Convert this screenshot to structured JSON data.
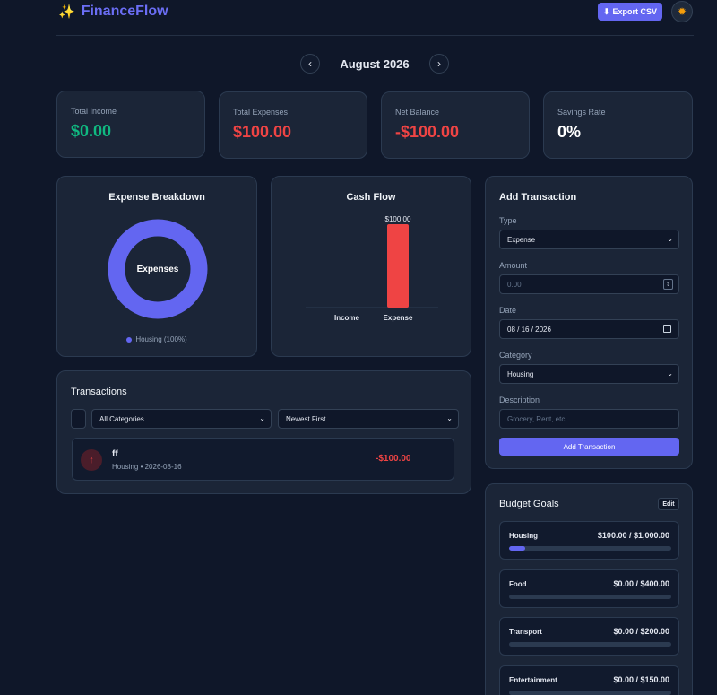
{
  "header": {
    "brand": "FinanceFlow",
    "brand_icon": "sparkles-icon",
    "export_label": "Export CSV",
    "theme_icon": "sun-icon"
  },
  "month_nav": {
    "label": "August 2026"
  },
  "stats": [
    {
      "label": "Total Income",
      "value": "$0.00",
      "color": "#10b981"
    },
    {
      "label": "Total Expenses",
      "value": "$100.00",
      "color": "#ef4444"
    },
    {
      "label": "Net Balance",
      "value": "-$100.00",
      "color": "#ef4444"
    },
    {
      "label": "Savings Rate",
      "value": "0%",
      "color": "#ffffff"
    }
  ],
  "expense_chart": {
    "title": "Expense Breakdown",
    "center_label": "Expenses",
    "legend": "Housing (100%)"
  },
  "cashflow_chart": {
    "title": "Cash Flow"
  },
  "chart_data": [
    {
      "type": "pie",
      "categories": [
        "Housing"
      ],
      "values": [
        100
      ],
      "colors": [
        "#6366f1"
      ]
    },
    {
      "type": "bar",
      "categories": [
        "Income",
        "Expense"
      ],
      "values": [
        0,
        100
      ],
      "data_labels": [
        "",
        "$100.00"
      ],
      "colors": [
        "#10b981",
        "#ef4444"
      ]
    }
  ],
  "add_form": {
    "title": "Add Transaction",
    "type_label": "Type",
    "type_value": "Expense",
    "amount_label": "Amount",
    "amount_placeholder": "0.00",
    "date_label": "Date",
    "date_value": "08 / 16 / 2026",
    "category_label": "Category",
    "category_value": "Housing",
    "description_label": "Description",
    "description_placeholder": "Grocery, Rent, etc.",
    "submit_label": "Add Transaction"
  },
  "transactions": {
    "title": "Transactions",
    "category_filter": "All Categories",
    "sort": "Newest First",
    "items": [
      {
        "name": "ff",
        "meta": "Housing • 2026-08-16",
        "amount": "-$100.00"
      }
    ]
  },
  "budget": {
    "title": "Budget Goals",
    "edit_label": "Edit",
    "goals": [
      {
        "name": "Housing",
        "value": "$100.00 / $1,000.00",
        "progress": 0.1
      },
      {
        "name": "Food",
        "value": "$0.00 / $400.00",
        "progress": 0
      },
      {
        "name": "Transport",
        "value": "$0.00 / $200.00",
        "progress": 0
      },
      {
        "name": "Entertainment",
        "value": "$0.00 / $150.00",
        "progress": 0
      }
    ]
  }
}
